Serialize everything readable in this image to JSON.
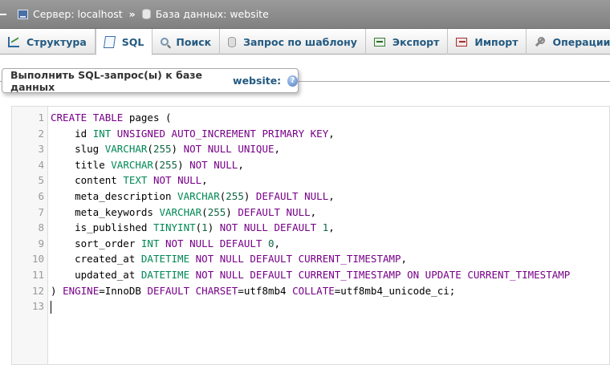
{
  "breadcrumb": {
    "server": "Сервер: localhost",
    "separator": "»",
    "database": "База данных: website"
  },
  "tabs": [
    {
      "label": "Структура",
      "icon": "structure-icon"
    },
    {
      "label": "SQL",
      "icon": "sql-icon",
      "active": true
    },
    {
      "label": "Поиск",
      "icon": "search-icon"
    },
    {
      "label": "Запрос по шаблону",
      "icon": "query-icon"
    },
    {
      "label": "Экспорт",
      "icon": "export-icon"
    },
    {
      "label": "Импорт",
      "icon": "import-icon"
    },
    {
      "label": "Операции",
      "icon": "operations-icon"
    }
  ],
  "legend": {
    "prefix": "Выполнить SQL-запрос(ы) к базе данных",
    "database": "website:",
    "help_glyph": "?"
  },
  "editor": {
    "line_numbers": [
      "1",
      "2",
      "3",
      "4",
      "5",
      "6",
      "7",
      "8",
      "9",
      "10",
      "11",
      "12",
      "13"
    ],
    "lines": [
      "CREATE TABLE pages (",
      "    id INT UNSIGNED AUTO_INCREMENT PRIMARY KEY,",
      "    slug VARCHAR(255) NOT NULL UNIQUE,",
      "    title VARCHAR(255) NOT NULL,",
      "    content TEXT NOT NULL,",
      "    meta_description VARCHAR(255) DEFAULT NULL,",
      "    meta_keywords VARCHAR(255) DEFAULT NULL,",
      "    is_published TINYINT(1) NOT NULL DEFAULT 1,",
      "    sort_order INT NOT NULL DEFAULT 0,",
      "    created_at DATETIME NOT NULL DEFAULT CURRENT_TIMESTAMP,",
      "    updated_at DATETIME NOT NULL DEFAULT CURRENT_TIMESTAMP ON UPDATE CURRENT_TIMESTAMP",
      ") ENGINE=InnoDB DEFAULT CHARSET=utf8mb4 COLLATE=utf8mb4_unicode_ci;",
      ""
    ]
  },
  "colors": {
    "keyword": "#770088",
    "type": "#008855",
    "number": "#116644",
    "link": "#235a81"
  }
}
